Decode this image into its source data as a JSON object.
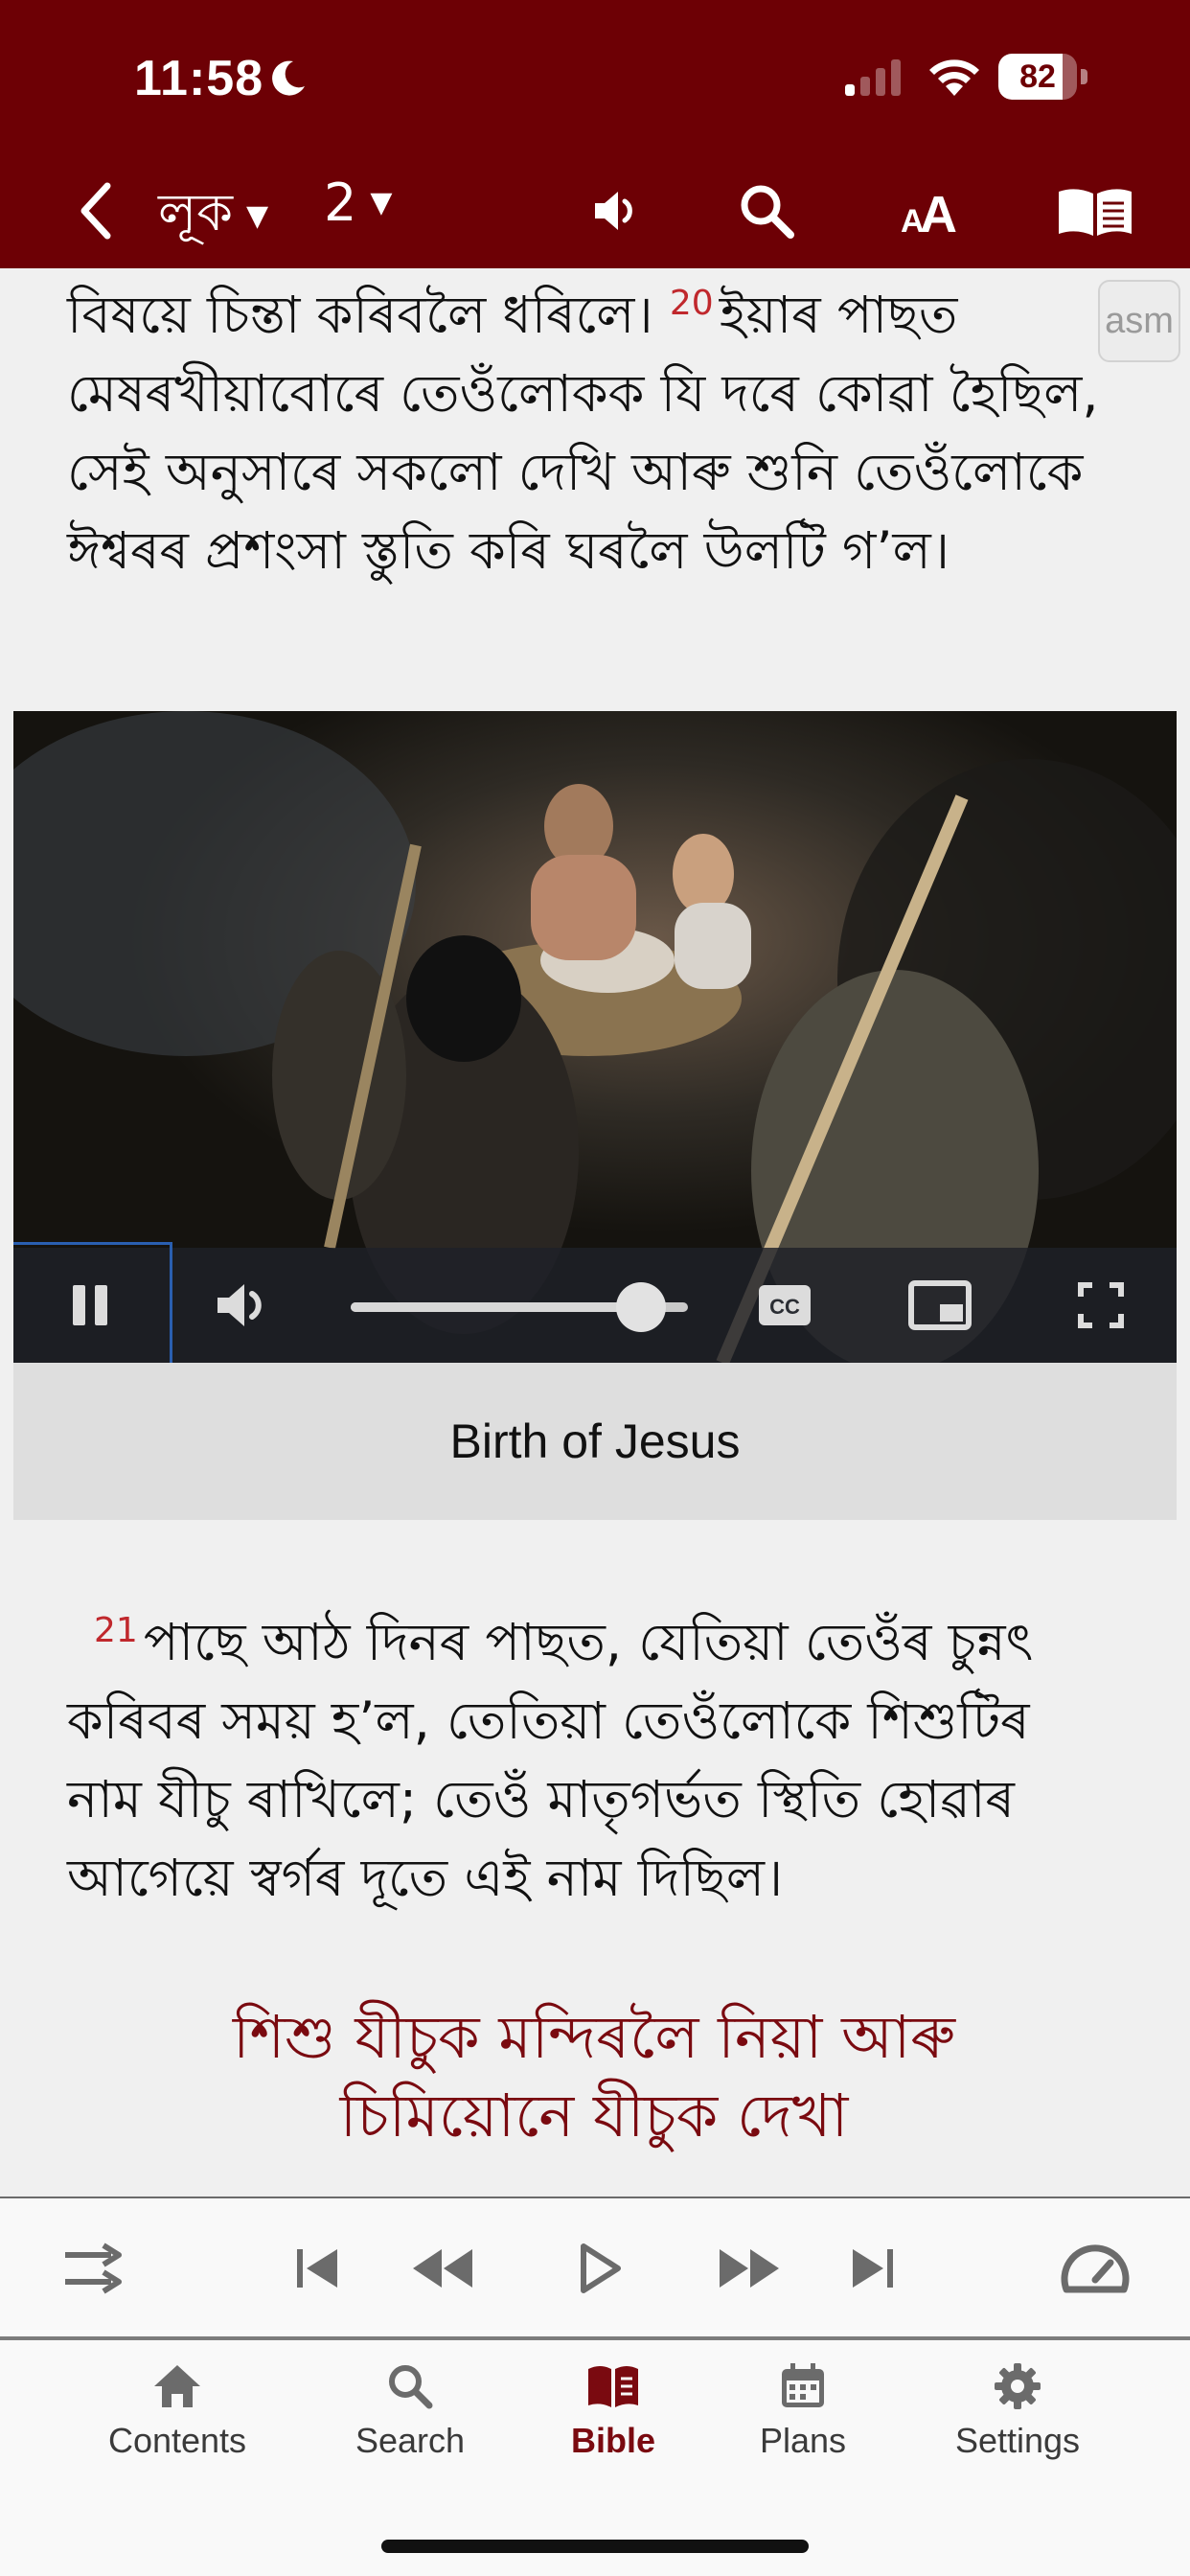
{
  "status_bar": {
    "time": "11:58",
    "battery": "82",
    "battery_level": 0.82
  },
  "toolbar": {
    "book": "লূক",
    "chapter": "2"
  },
  "language_badge": "asm",
  "passage": {
    "p1": "বিষয়ে চিন্তা কৰিবলৈ ধৰিলে।",
    "v20_num": "20",
    "v20_text": "ইয়াৰ পাছত মেষৰখীয়াবোৰে তেওঁলোকক যি দৰে কোৱা হৈছিল, সেই অনুসাৰে সকলো দেখি আৰু শুনি তেওঁলোকে ঈশ্বৰৰ প্ৰশংসা স্তুতি কৰি ঘৰলৈ উলটি গ’ল।",
    "v21_num": "21",
    "v21_text": "পাছে আঠ দিনৰ পাছত, যেতিয়া তেওঁৰ চুন্নৎ কৰিবৰ সময় হ’ল, তেতিয়া তেওঁলোকে শিশুটিৰ নাম যীচু ৰাখিলে; তেওঁ মাতৃগৰ্ভত স্থিতি হোৱাৰ আগেয়ে স্বৰ্গৰ দূতে এই নাম দিছিল।",
    "heading_line1": "শিশু যীচুক মন্দিৰলৈ নিয়া আৰু",
    "heading_line2": "চিমিয়োনে যীচুক দেখা"
  },
  "video": {
    "caption": "Birth of Jesus",
    "progress": 0.86
  },
  "audio_controls": [
    "shuffle-icon",
    "skip-start-icon",
    "rewind-icon",
    "play-icon",
    "fast-forward-icon",
    "skip-end-icon",
    "speed-icon"
  ],
  "tabs": [
    {
      "label": "Contents",
      "icon": "home-icon"
    },
    {
      "label": "Search",
      "icon": "search-icon"
    },
    {
      "label": "Bible",
      "icon": "bible-book-icon",
      "active": true
    },
    {
      "label": "Plans",
      "icon": "calendar-icon"
    },
    {
      "label": "Settings",
      "icon": "gear-icon"
    }
  ],
  "colors": {
    "brand": "#6d0005",
    "verse_number": "#c0282d",
    "heading": "#7a0a10",
    "background": "#f0f0f0"
  }
}
